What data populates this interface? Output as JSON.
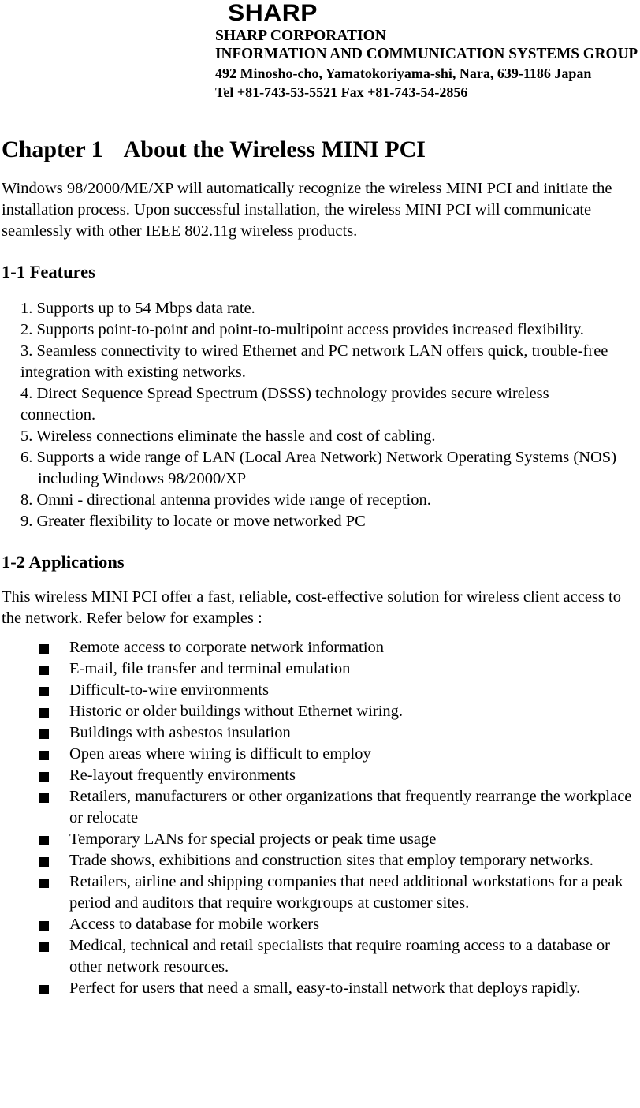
{
  "letterhead": {
    "logo_text": "SHARP",
    "company": "SHARP CORPORATION",
    "division": "INFORMATION AND COMMUNICATION SYSTEMS GROUP",
    "address": "492 Minosho-cho, Yamatokoriyama-shi, Nara, 639-1186 Japan",
    "contact": "Tel +81-743-53-5521 Fax +81-743-54-2856"
  },
  "chapter": {
    "number_label": "Chapter 1",
    "title": "About the Wireless MINI PCI",
    "intro": "Windows 98/2000/ME/XP will automatically recognize the wireless MINI PCI and initiate the installation process. Upon successful installation, the wireless MINI PCI will communicate seamlessly with other IEEE 802.11g wireless products."
  },
  "features_section": {
    "heading": "1-1 Features",
    "items": [
      {
        "text": "1. Supports up to 54 Mbps data rate.",
        "indented": false
      },
      {
        "text": "2. Supports point-to-point and point-to-multipoint access provides increased flexibility.",
        "indented": false
      },
      {
        "text": "3. Seamless connectivity to wired Ethernet and PC network LAN offers quick, trouble-free integration with existing networks.",
        "indented": false
      },
      {
        "text": "4. Direct Sequence Spread Spectrum (DSSS) technology provides secure wireless connection.",
        "indented": false
      },
      {
        "text": "5. Wireless connections eliminate the hassle and cost of cabling.",
        "indented": false
      },
      {
        "text": "6. Supports a wide range of LAN (Local Area Network) Network Operating Systems (NOS)",
        "indented": false
      },
      {
        "text": "including Windows 98/2000/XP",
        "indented": true
      },
      {
        "text": "8. Omni - directional antenna provides wide range of reception.",
        "indented": false
      },
      {
        "text": "9. Greater flexibility to locate or move networked PC",
        "indented": false
      }
    ]
  },
  "applications_section": {
    "heading": "1-2 Applications",
    "intro": "This wireless MINI PCI offer a fast, reliable, cost-effective solution for wireless client access to the network. Refer below for examples :",
    "bullet_glyph": "filled-square",
    "items": [
      "Remote access to corporate network information",
      "E-mail, file transfer and terminal emulation",
      "Difficult-to-wire environments",
      "Historic or older buildings without Ethernet wiring.",
      "Buildings with asbestos insulation",
      "Open areas where wiring is difficult to employ",
      "Re-layout frequently environments",
      "Retailers, manufacturers or other organizations that frequently rearrange the workplace or relocate",
      "Temporary LANs for special projects or peak time usage",
      "Trade shows, exhibitions and construction sites that employ temporary networks.",
      "Retailers, airline and shipping companies that need additional workstations for a peak period and auditors that require workgroups at customer sites.",
      "Access to database for mobile workers",
      "Medical, technical and retail specialists that require roaming access to a database or other network resources.",
      "Perfect for users that need a small, easy-to-install network that deploys rapidly."
    ]
  },
  "colors": {
    "text": "#000000",
    "background": "#ffffff"
  }
}
